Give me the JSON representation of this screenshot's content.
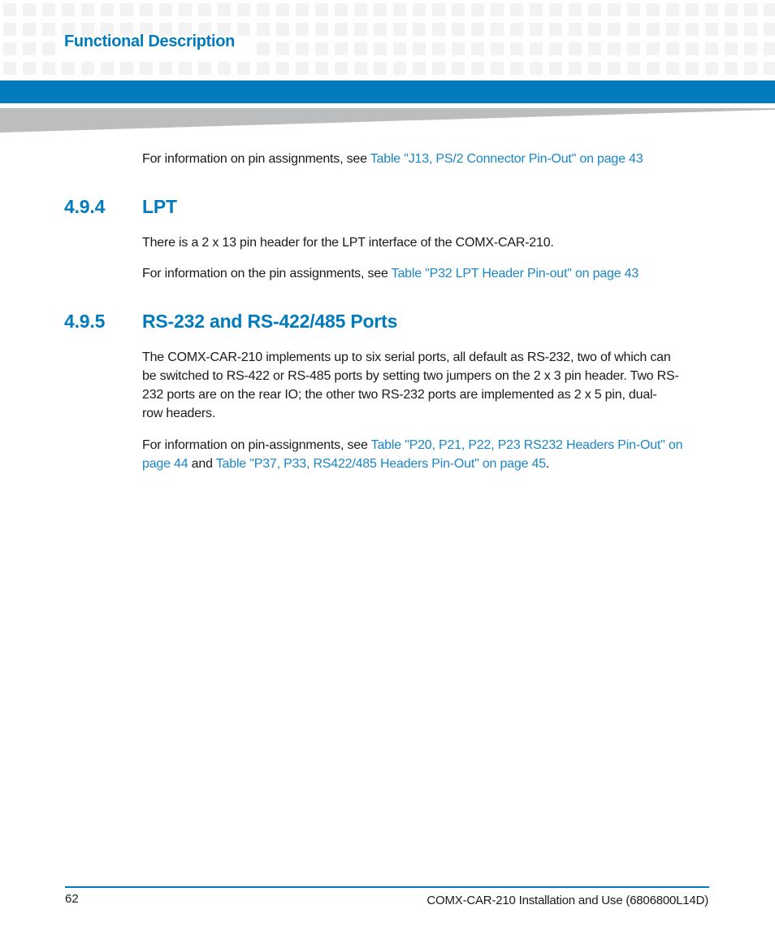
{
  "header": {
    "chapter_title": "Functional Description",
    "accent_color": "#007bbd"
  },
  "intro": {
    "text": "For information on pin assignments, see ",
    "link": "Table \"J13, PS/2 Connector Pin-Out\" on page 43"
  },
  "section_lpt": {
    "number": "4.9.4",
    "title": "LPT",
    "para1": "There is a 2 x 13 pin header for the LPT interface of the COMX-CAR-210.",
    "para2_text": "For information on the pin assignments, see ",
    "para2_link": "Table \"P32 LPT Header Pin-out\" on page 43"
  },
  "section_serial": {
    "number": "4.9.5",
    "title": "RS-232 and RS-422/485 Ports",
    "para1_lines": [
      "The COMX-CAR-210 implements up to six serial ports, all default as RS-232, two of which can",
      "be switched to RS-422 or RS-485 ports by setting two jumpers on the 2 x 3 pin header. Two RS-",
      "232 ports are on the rear IO; the other two RS-232 ports are implemented as 2 x 5 pin, dual-",
      "row headers."
    ],
    "para2_text": "For information on pin-assignments, see ",
    "para2_link1_line1": "Table \"P20, P21, P22, P23 RS232 Headers Pin-Out\" on",
    "para2_link1_line2": "page 44",
    "para2_and": " and ",
    "para2_link2": "Table \"P37, P33, RS422/485 Headers Pin-Out\" on page 45",
    "para2_end": "."
  },
  "footer": {
    "page_number": "62",
    "document_title": "COMX-CAR-210 Installation and Use (6806800L14D)"
  }
}
